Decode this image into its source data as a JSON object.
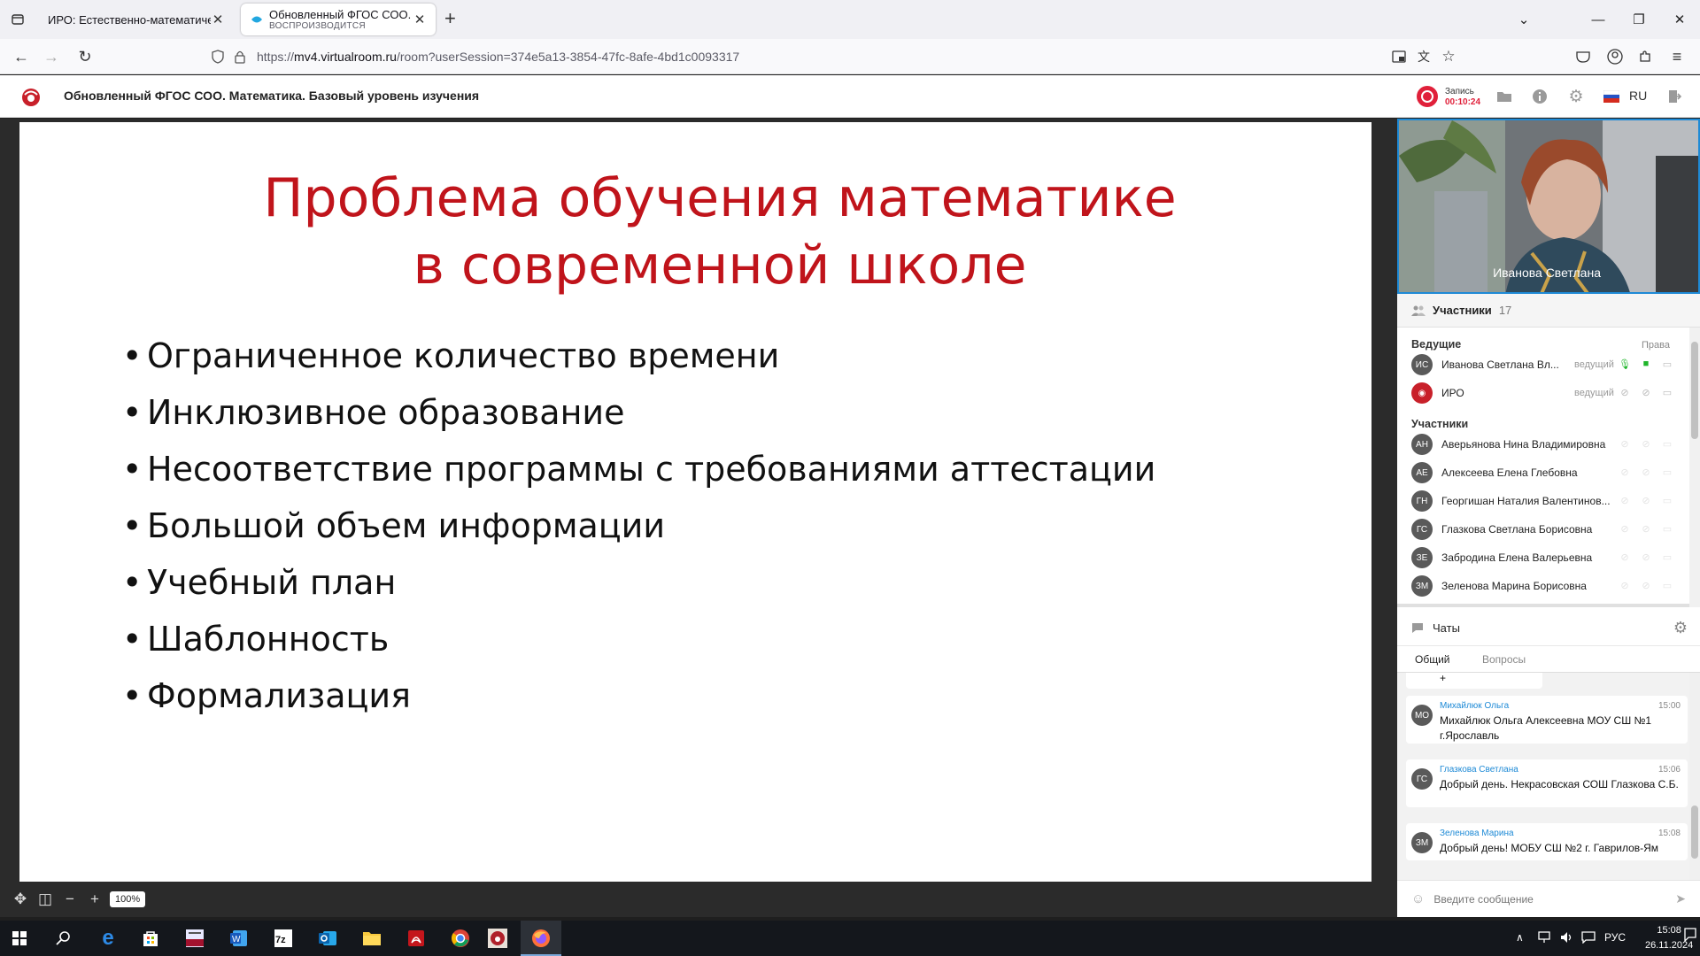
{
  "browser": {
    "tabs": [
      {
        "title": "ИРО: Естественно-математическ",
        "active": false
      },
      {
        "title": "Обновленный ФГОС СОО. Математика",
        "subtitle": "ВОСПРОИЗВОДИТСЯ",
        "active": true
      }
    ],
    "url_prefix": "https://",
    "url_domain": "mv4.virtualroom.ru",
    "url_path": "/room?userSession=374e5a13-3854-47fc-8afe-4bd1c0093317"
  },
  "app": {
    "title": "Обновленный ФГОС СОО. Математика. Базовый уровень изучения",
    "record_label": "Запись",
    "record_time": "00:10:24",
    "language": "RU",
    "accent_color": "#e0203a"
  },
  "slide": {
    "title_line1": "Проблема обучения математике",
    "title_line2": "в современной школе",
    "bullets": [
      "Ограниченное количество времени",
      "Инклюзивное образование",
      "Несоответствие программы с требованиями аттестации",
      "Большой объем информации",
      "Учебный план",
      "Шаблонность",
      "Формализация"
    ],
    "zoom": "100%"
  },
  "video": {
    "name": "Иванова Светлана"
  },
  "participants": {
    "label": "Участники",
    "count": "17",
    "hosts_label": "Ведущие",
    "rights_label": "Права",
    "members_label": "Участники",
    "hosts": [
      {
        "initials": "ИС",
        "name": "Иванова Светлана Вл...",
        "role": "ведущий"
      },
      {
        "initials": "",
        "name": "ИРО",
        "role": "ведущий"
      }
    ],
    "members": [
      {
        "initials": "АН",
        "name": "Аверьянова Нина Владимировна"
      },
      {
        "initials": "АЕ",
        "name": "Алексеева Елена Глебовна"
      },
      {
        "initials": "ГН",
        "name": "Георгишан Наталия Валентинов..."
      },
      {
        "initials": "ГС",
        "name": "Глазкова Светлана Борисовна"
      },
      {
        "initials": "ЗЕ",
        "name": "Забродина Елена Валерьевна"
      },
      {
        "initials": "ЗМ",
        "name": "Зеленова Марина Борисовна"
      }
    ]
  },
  "chat": {
    "title": "Чаты",
    "tab_general": "Общий",
    "tab_questions": "Вопросы",
    "partial_text": "+",
    "messages": [
      {
        "initials": "МО",
        "author": "Михайлюк Ольга",
        "time": "15:00",
        "text": "Михайлюк Ольга Алексеевна МОУ СШ №1 г.Ярославль"
      },
      {
        "initials": "ГС",
        "author": "Глазкова Светлана",
        "time": "15:06",
        "text": "Добрый день. Некрасовская СОШ Глазкова С.Б."
      },
      {
        "initials": "ЗМ",
        "author": "Зеленова Марина",
        "time": "15:08",
        "text": "Добрый день! МОБУ СШ №2 г. Гаврилов-Ям"
      }
    ],
    "input_placeholder": "Введите сообщение"
  },
  "taskbar": {
    "lang": "РУС",
    "time": "15:08",
    "date": "26.11.2024"
  }
}
